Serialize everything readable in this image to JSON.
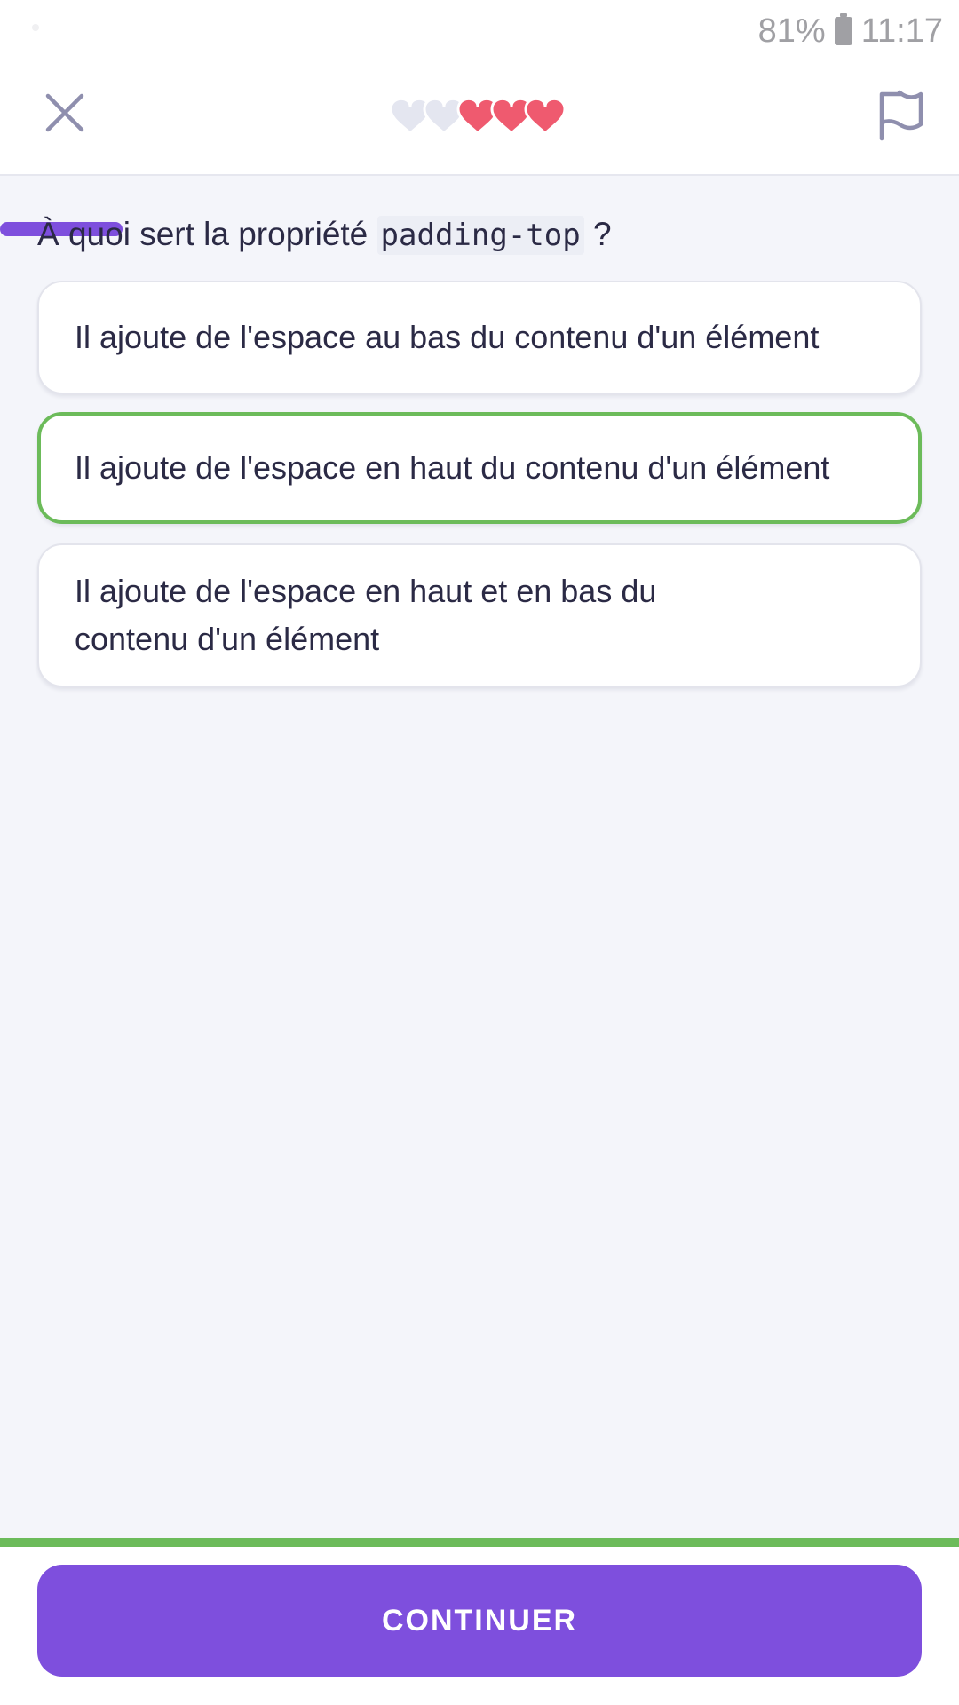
{
  "status_bar": {
    "battery": "81%",
    "time": "11:17",
    "battery_icon": "battery-icon"
  },
  "header": {
    "close_icon": "close-icon",
    "flag_icon": "flag-icon",
    "lives_total": 5,
    "lives_remaining": 3,
    "heart_full_color": "#ef5a6f",
    "heart_empty_color": "#e4e6f0",
    "progress_fraction": 0.128,
    "progress_color": "#7e4fdd"
  },
  "question": {
    "before": "À quoi sert la propriété",
    "code": "padding-top",
    "after": "?"
  },
  "options": [
    {
      "label": "Il ajoute de l'espace au bas du contenu d'un élément",
      "selected": false
    },
    {
      "label": "Il ajoute de l'espace en haut du contenu d'un élément",
      "selected": true
    },
    {
      "label": "Il ajoute de l'espace en haut et en bas du contenu d'un élément",
      "selected": false
    }
  ],
  "footer": {
    "continue_label": "CONTINUER",
    "accent_color": "#7e4fdd",
    "correct_color": "#6cbb5a"
  }
}
